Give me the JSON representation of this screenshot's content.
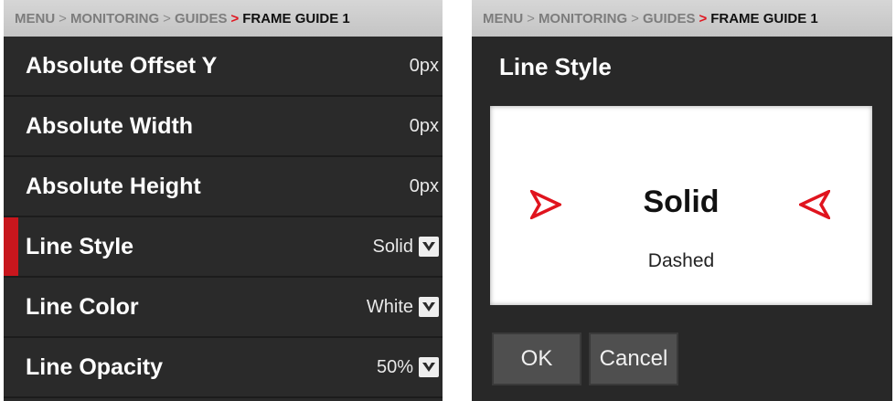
{
  "left": {
    "breadcrumb": {
      "items": [
        "MENU",
        "MONITORING",
        "GUIDES"
      ],
      "sep": ">",
      "current": "FRAME GUIDE 1"
    },
    "rows": [
      {
        "label": "Absolute Offset Y",
        "value": "0px"
      },
      {
        "label": "Absolute Width",
        "value": "0px"
      },
      {
        "label": "Absolute Height",
        "value": "0px"
      },
      {
        "label": "Line Style",
        "value": "Solid"
      },
      {
        "label": "Line Color",
        "value": "White"
      },
      {
        "label": "Line Opacity",
        "value": "50%"
      }
    ]
  },
  "right": {
    "breadcrumb": {
      "items": [
        "MENU",
        "MONITORING",
        "GUIDES"
      ],
      "sep": ">",
      "current": "FRAME GUIDE 1"
    },
    "title": "Line Style",
    "picker": {
      "selected": "Solid",
      "next": "Dashed"
    },
    "buttons": {
      "ok": "OK",
      "cancel": "Cancel"
    }
  },
  "colors": {
    "accent": "#c8161d",
    "arrow": "#e0141e",
    "panel_bg": "#2a2a2a"
  },
  "icons": [
    "chevron-down-icon",
    "picker-arrow-left-icon",
    "picker-arrow-right-icon"
  ]
}
